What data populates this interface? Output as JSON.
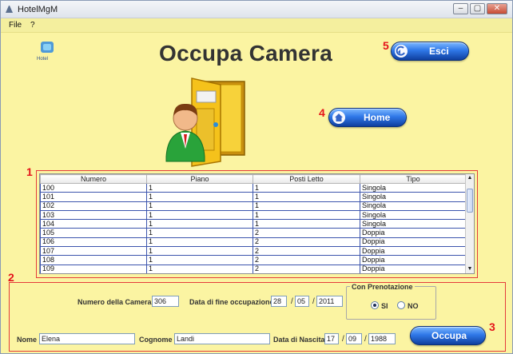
{
  "window": {
    "title": "HotelMgM",
    "controls": {
      "minimize": "–",
      "maximize": "▢",
      "close": "✕"
    }
  },
  "menu": {
    "items": [
      "File",
      "?"
    ]
  },
  "logo": {
    "text": "Hotel"
  },
  "page": {
    "title": "Occupa Camera"
  },
  "markers": {
    "m1": "1",
    "m2": "2",
    "m3": "3",
    "m4": "4",
    "m5": "5"
  },
  "buttons": {
    "exit_label": "Esci",
    "home_label": "Home",
    "occupy_label": "Occupa"
  },
  "table": {
    "columns": [
      "Numero",
      "Piano",
      "Posti Letto",
      "Tipo"
    ],
    "rows": [
      [
        "100",
        "1",
        "1",
        "Singola"
      ],
      [
        "101",
        "1",
        "1",
        "Singola"
      ],
      [
        "102",
        "1",
        "1",
        "Singola"
      ],
      [
        "103",
        "1",
        "1",
        "Singola"
      ],
      [
        "104",
        "1",
        "1",
        "Singola"
      ],
      [
        "105",
        "1",
        "2",
        "Doppia"
      ],
      [
        "106",
        "1",
        "2",
        "Doppia"
      ],
      [
        "107",
        "1",
        "2",
        "Doppia"
      ],
      [
        "108",
        "1",
        "2",
        "Doppia"
      ],
      [
        "109",
        "1",
        "2",
        "Doppia"
      ]
    ]
  },
  "form": {
    "room_label": "Numero della Camera",
    "room_value": "306",
    "end_date_label": "Data di fine occupazione",
    "end_day": "28",
    "end_month": "05",
    "end_year": "2011",
    "date_sep": "/",
    "reservation_title": "Con Prenotazione",
    "radio_yes": "SI",
    "radio_no": "NO",
    "name_label": "Nome",
    "name_value": "Elena",
    "surname_label": "Cognome",
    "surname_value": "Landi",
    "birth_label": "Data di Nascita",
    "birth_day": "17",
    "birth_month": "09",
    "birth_year": "1988"
  },
  "colors": {
    "background": "#fbf4a2",
    "marker": "#e4131a",
    "button": "#2f78e8"
  }
}
